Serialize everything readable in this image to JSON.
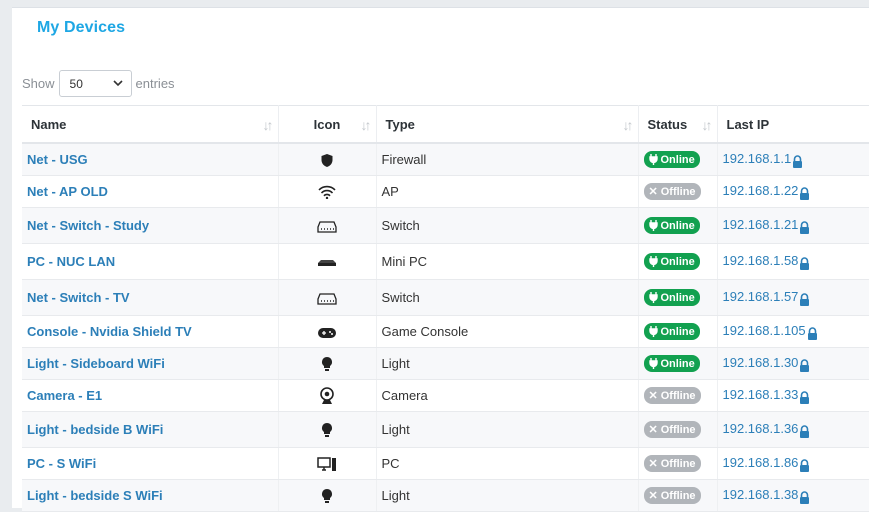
{
  "page": {
    "title": "My Devices"
  },
  "length": {
    "show_label": "Show",
    "value": "50",
    "entries_label": "entries"
  },
  "table": {
    "headers": {
      "name": "Name",
      "icon": "Icon",
      "type": "Type",
      "status": "Status",
      "last_ip": "Last IP"
    },
    "rows": [
      {
        "name": "Net - USG",
        "icon": "shield-icon",
        "type": "Firewall",
        "status": "Online",
        "ip": "192.168.1.1"
      },
      {
        "name": "Net - AP OLD",
        "icon": "wifi-icon",
        "type": "AP",
        "status": "Offline",
        "ip": "192.168.1.22"
      },
      {
        "name": "Net - Switch - Study",
        "icon": "switch-icon",
        "type": "Switch",
        "status": "Online",
        "ip": "192.168.1.21"
      },
      {
        "name": "PC - NUC LAN",
        "icon": "mini-pc-icon",
        "type": "Mini PC",
        "status": "Online",
        "ip": "192.168.1.58"
      },
      {
        "name": "Net - Switch - TV",
        "icon": "switch-icon",
        "type": "Switch",
        "status": "Online",
        "ip": "192.168.1.57"
      },
      {
        "name": "Console - Nvidia Shield TV",
        "icon": "gamepad-icon",
        "type": "Game Console",
        "status": "Online",
        "ip": "192.168.1.105"
      },
      {
        "name": "Light - Sideboard WiFi",
        "icon": "lightbulb-icon",
        "type": "Light",
        "status": "Online",
        "ip": "192.168.1.30"
      },
      {
        "name": "Camera - E1",
        "icon": "camera-icon",
        "type": "Camera",
        "status": "Offline",
        "ip": "192.168.1.33"
      },
      {
        "name": "Light - bedside B WiFi",
        "icon": "lightbulb-icon",
        "type": "Light",
        "status": "Offline",
        "ip": "192.168.1.36"
      },
      {
        "name": "PC - S WiFi",
        "icon": "desktop-pc-icon",
        "type": "PC",
        "status": "Offline",
        "ip": "192.168.1.86"
      },
      {
        "name": "Light - bedside S WiFi",
        "icon": "lightbulb-icon",
        "type": "Light",
        "status": "Offline",
        "ip": "192.168.1.38"
      }
    ]
  },
  "colors": {
    "accent": "#1ea7e4",
    "link": "#2c7fb8",
    "online": "#12a150",
    "offline": "#b1b5ba"
  }
}
